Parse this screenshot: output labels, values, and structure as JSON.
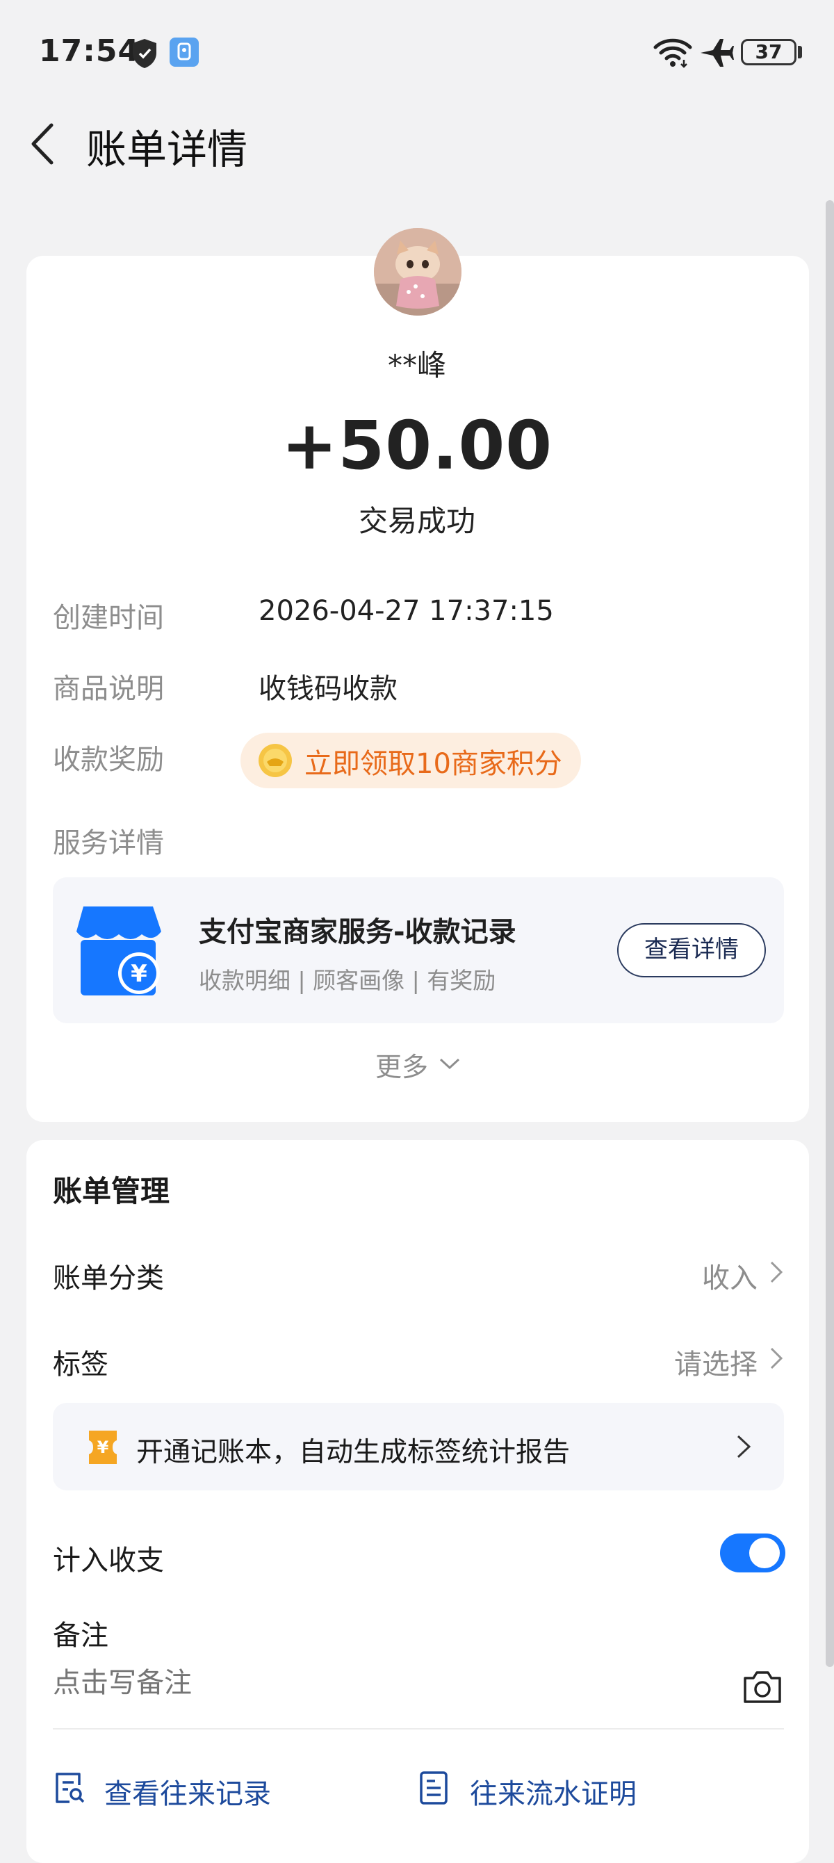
{
  "status_bar": {
    "time": "17:54",
    "battery": "37",
    "icons": [
      "shield-icon",
      "app-status-icon",
      "wifi-icon",
      "airplane-mode-icon",
      "battery-icon"
    ]
  },
  "header": {
    "title": "账单详情",
    "back_icon": "chevron-left-icon"
  },
  "transaction": {
    "payer_name": "**峰",
    "amount": "+50.00",
    "status": "交易成功",
    "details": [
      {
        "label": "创建时间",
        "value": "2026-04-27 17:37:15"
      },
      {
        "label": "商品说明",
        "value": "收钱码收款"
      },
      {
        "label": "收款奖励",
        "value": "立即领取10商家积分"
      },
      {
        "label": "服务详情",
        "value": ""
      }
    ]
  },
  "service_card": {
    "title": "支付宝商家服务-收款记录",
    "subtitle": "收款明细 | 顾客画像 | 有奖励",
    "button_label": "查看详情"
  },
  "more": {
    "label": "更多"
  },
  "bill_management": {
    "title": "账单管理",
    "category": {
      "label": "账单分类",
      "value": "收入"
    },
    "tag": {
      "label": "标签",
      "value": "请选择"
    },
    "promo": "开通记账本，自动生成标签统计报告",
    "include_in_stats": {
      "label": "计入收支",
      "enabled": true
    },
    "remark": {
      "label": "备注",
      "placeholder": "点击写备注"
    }
  },
  "bottom_links": [
    {
      "label": "查看往来记录",
      "icon": "record-search-icon"
    },
    {
      "label": "往来流水证明",
      "icon": "statement-doc-icon"
    }
  ],
  "colors": {
    "accent_blue": "#1677ff",
    "link_blue": "#1d4a9c",
    "reward_orange": "#e86a1a",
    "reward_bg": "#fdeee0",
    "background": "#f2f2f3"
  }
}
